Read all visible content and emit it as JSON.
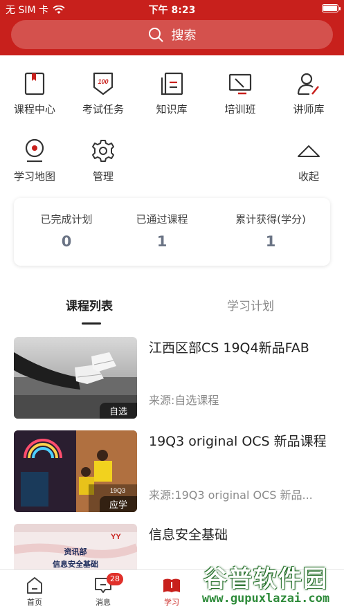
{
  "status_bar": {
    "carrier": "无 SIM 卡",
    "time": "下午 8:23"
  },
  "search": {
    "placeholder": "搜索"
  },
  "menu": [
    {
      "label": "课程中心",
      "icon": "book-icon"
    },
    {
      "label": "考试任务",
      "icon": "exam-badge-icon"
    },
    {
      "label": "知识库",
      "icon": "knowledge-icon"
    },
    {
      "label": "培训班",
      "icon": "classroom-icon"
    },
    {
      "label": "讲师库",
      "icon": "lecturer-icon"
    },
    {
      "label": "学习地图",
      "icon": "map-pin-icon"
    },
    {
      "label": "管理",
      "icon": "gear-icon"
    },
    {
      "label": "收起",
      "icon": "collapse-icon"
    }
  ],
  "stats": [
    {
      "title": "已完成计划",
      "value": "0"
    },
    {
      "title": "已通过课程",
      "value": "1"
    },
    {
      "title": "累计获得(学分)",
      "value": "1"
    }
  ],
  "tabs": {
    "active": "课程列表",
    "inactive": "学习计划"
  },
  "courses": [
    {
      "title": "江西区部CS 19Q4新品FAB",
      "source": "来源:自选课程",
      "badge": "自选"
    },
    {
      "title": "19Q3 original OCS 新品课程",
      "source": "来源:19Q3 original OCS 新品...",
      "badge": "应学",
      "thumb_caption": "19Q3"
    },
    {
      "title": "信息安全基础",
      "thumb_caption_1": "资讯部",
      "thumb_caption_2": "信息安全基础"
    }
  ],
  "tabbar": [
    {
      "label": "首页"
    },
    {
      "label": "消息",
      "badge": "28"
    },
    {
      "label": "学习"
    }
  ],
  "watermark": {
    "main": "谷普软件园",
    "sub": "www.gupuxlazai.com"
  },
  "colors": {
    "brand": "#c8201c",
    "badge": "#e0302a",
    "stat_value": "#6b7485"
  }
}
